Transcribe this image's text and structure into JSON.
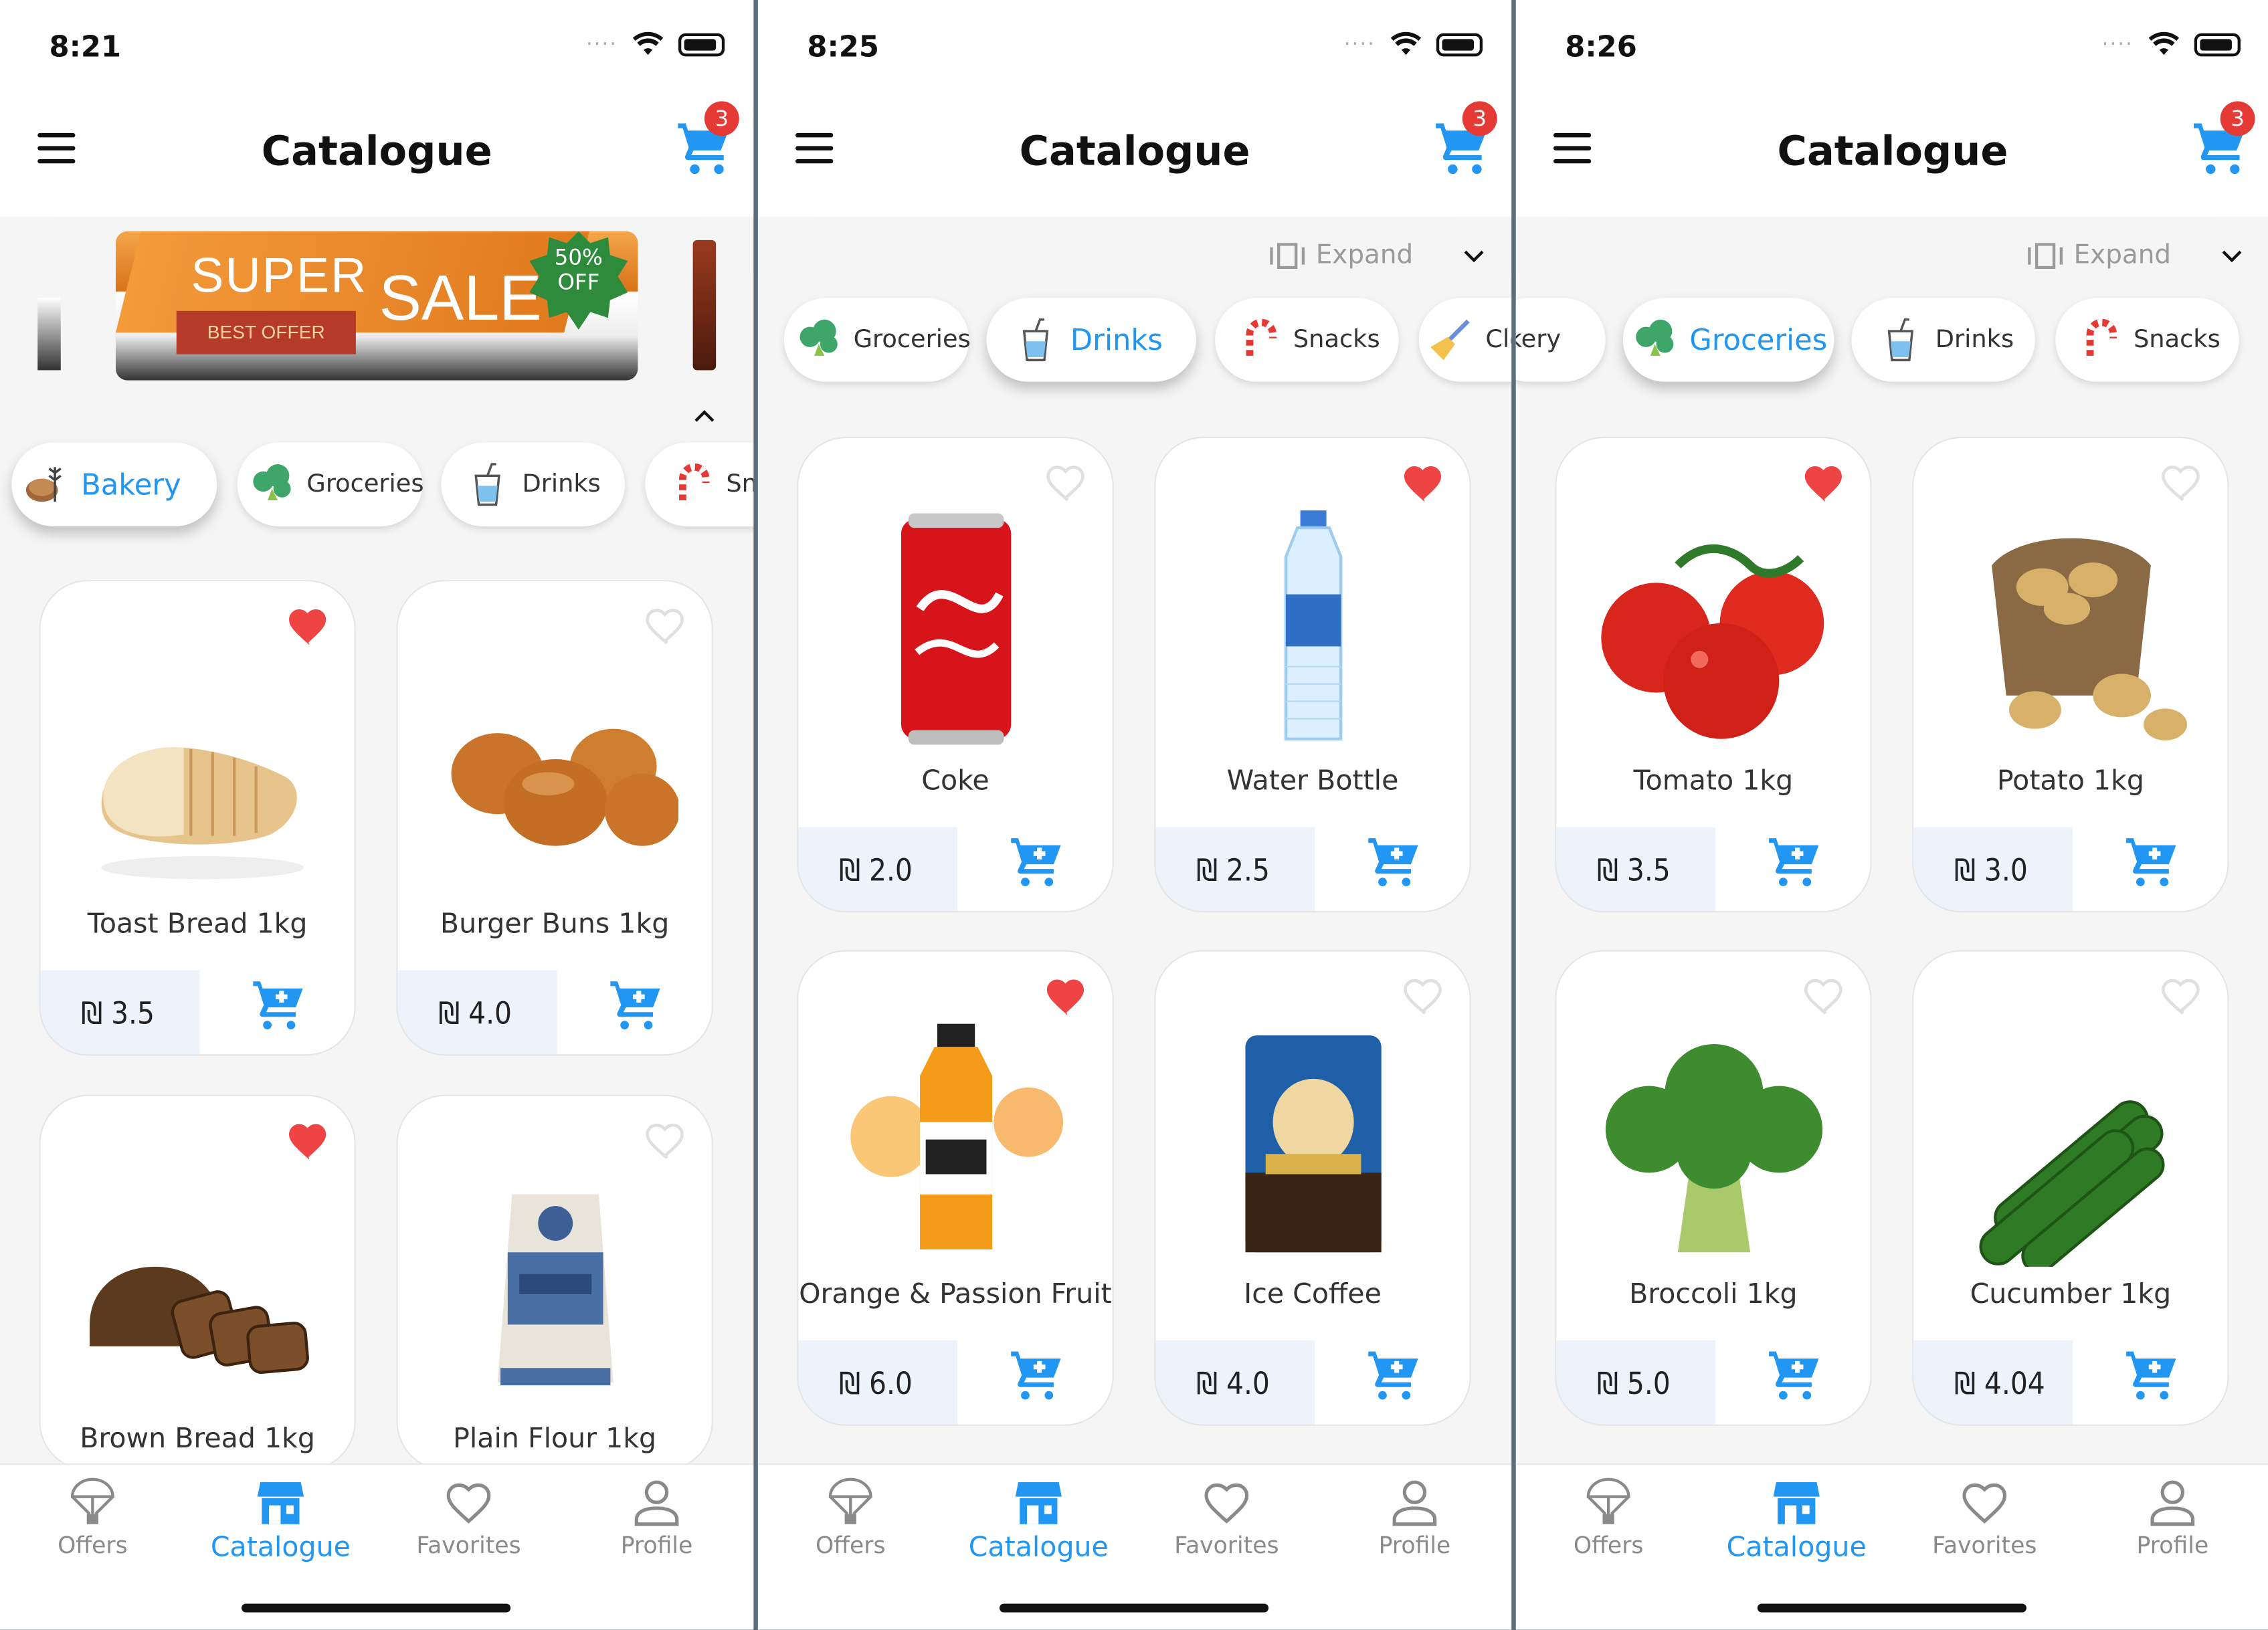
{
  "screens": [
    {
      "time": "8:21",
      "title": "Catalogue",
      "cart_count": "3",
      "banner": {
        "super": "SUPER",
        "sale": "SALE",
        "best": "BEST OFFER",
        "off": "50%\nOFF"
      },
      "chips": [
        {
          "label": "Bakery",
          "icon": "bread-icon",
          "active": true
        },
        {
          "label": "Groceries",
          "icon": "broccoli-icon",
          "active": false
        },
        {
          "label": "Drinks",
          "icon": "cup-icon",
          "active": false
        },
        {
          "label": "Sn",
          "icon": "candy-cane-icon",
          "active": false
        }
      ],
      "products": [
        {
          "name": "Toast Bread 1kg",
          "price": "₪ 3.5",
          "favorite": true
        },
        {
          "name": "Burger Buns 1kg",
          "price": "₪ 4.0",
          "favorite": false
        },
        {
          "name": "Brown Bread 1kg",
          "price": "",
          "favorite": true
        },
        {
          "name": "Plain Flour 1kg",
          "price": "",
          "favorite": false
        }
      ]
    },
    {
      "time": "8:25",
      "title": "Catalogue",
      "cart_count": "3",
      "expand_label": "Expand",
      "chips": [
        {
          "label": "Groceries",
          "icon": "broccoli-icon",
          "active": false
        },
        {
          "label": "Drinks",
          "icon": "cup-icon",
          "active": true
        },
        {
          "label": "Snacks",
          "icon": "candy-cane-icon",
          "active": false
        },
        {
          "label": "Cleaning",
          "icon": "broom-icon",
          "active": false
        }
      ],
      "products": [
        {
          "name": "Coke",
          "price": "₪ 2.0",
          "favorite": false
        },
        {
          "name": "Water Bottle",
          "price": "₪ 2.5",
          "favorite": true
        },
        {
          "name": "Orange & Passion Fruit",
          "price": "₪ 6.0",
          "favorite": true
        },
        {
          "name": "Ice Coffee",
          "price": "₪ 4.0",
          "favorite": false
        }
      ]
    },
    {
      "time": "8:26",
      "title": "Catalogue",
      "cart_count": "3",
      "expand_label": "Expand",
      "chips": [
        {
          "label": "akery",
          "icon": "bread-icon",
          "active": false
        },
        {
          "label": "Groceries",
          "icon": "broccoli-icon",
          "active": true
        },
        {
          "label": "Drinks",
          "icon": "cup-icon",
          "active": false
        },
        {
          "label": "Snacks",
          "icon": "candy-cane-icon",
          "active": false
        }
      ],
      "products": [
        {
          "name": "Tomato 1kg",
          "price": "₪ 3.5",
          "favorite": true
        },
        {
          "name": "Potato 1kg",
          "price": "₪ 3.0",
          "favorite": false
        },
        {
          "name": "Broccoli 1kg",
          "price": "₪ 5.0",
          "favorite": false
        },
        {
          "name": "Cucumber 1kg",
          "price": "₪ 4.04",
          "favorite": false
        }
      ]
    }
  ],
  "nav": [
    {
      "label": "Offers",
      "icon": "parachute-icon"
    },
    {
      "label": "Catalogue",
      "icon": "store-icon"
    },
    {
      "label": "Favorites",
      "icon": "heart-outline-icon"
    },
    {
      "label": "Profile",
      "icon": "person-icon"
    }
  ],
  "colors": {
    "accent": "#2196f3",
    "favorite": "#ef4444",
    "badge": "#e53935",
    "price_bg": "#edf3fb"
  }
}
